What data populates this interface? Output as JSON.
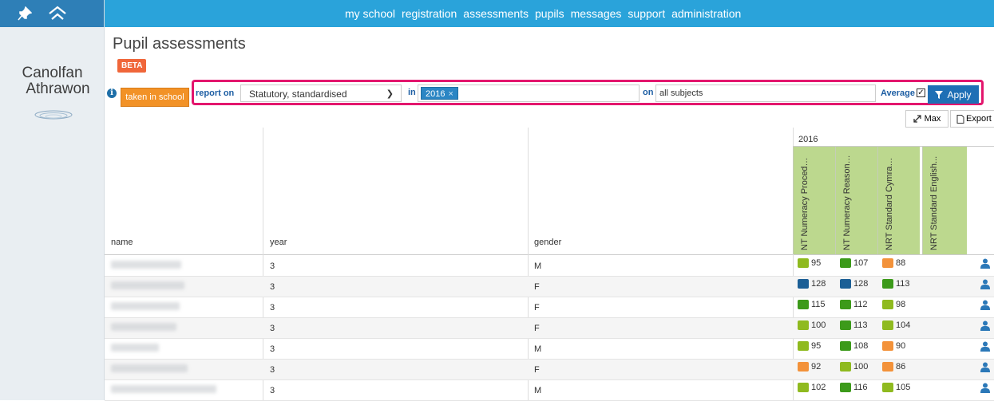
{
  "nav": {
    "items": [
      "my school",
      "registration",
      "assessments",
      "pupils",
      "messages",
      "support",
      "administration"
    ]
  },
  "brand": {
    "line1": "Canolfan",
    "line2": "Athrawon"
  },
  "page": {
    "title": "Pupil assessments",
    "badge": "BETA"
  },
  "filters": {
    "info_icon": "i",
    "taken_label": "taken in school",
    "report_on_label": "report on",
    "report_on_value": "Statutory, standardised",
    "in_label": "in",
    "in_chip": "2016",
    "on_label": "on",
    "on_value": "all subjects",
    "average_label": "Average",
    "average_checked": true,
    "apply_label": "Apply"
  },
  "toolbar": {
    "max_label": "Max",
    "export_label": "Export"
  },
  "table": {
    "headers": {
      "name": "name",
      "year": "year",
      "gender": "gender"
    },
    "year_group": "2016",
    "subjects": [
      "NT Numeracy Procedu...",
      "NT Numeracy Reasoni...",
      "NRT Standard Cymrae...",
      "NRT Standard English..."
    ],
    "rows": [
      {
        "year": "3",
        "gender": "M",
        "scores": [
          [
            "95",
            "lightgreen"
          ],
          [
            "107",
            "green"
          ],
          [
            "88",
            "orange"
          ]
        ]
      },
      {
        "year": "3",
        "gender": "F",
        "scores": [
          [
            "128",
            "blue"
          ],
          [
            "128",
            "blue"
          ],
          [
            "113",
            "green"
          ]
        ]
      },
      {
        "year": "3",
        "gender": "F",
        "scores": [
          [
            "115",
            "green"
          ],
          [
            "112",
            "green"
          ],
          [
            "98",
            "lightgreen"
          ]
        ]
      },
      {
        "year": "3",
        "gender": "F",
        "scores": [
          [
            "100",
            "lightgreen"
          ],
          [
            "113",
            "green"
          ],
          [
            "104",
            "lightgreen"
          ]
        ]
      },
      {
        "year": "3",
        "gender": "M",
        "scores": [
          [
            "95",
            "lightgreen"
          ],
          [
            "108",
            "green"
          ],
          [
            "90",
            "orange"
          ]
        ]
      },
      {
        "year": "3",
        "gender": "F",
        "scores": [
          [
            "92",
            "orange"
          ],
          [
            "100",
            "lightgreen"
          ],
          [
            "86",
            "orange"
          ]
        ]
      },
      {
        "year": "3",
        "gender": "M",
        "scores": [
          [
            "102",
            "lightgreen"
          ],
          [
            "116",
            "green"
          ],
          [
            "105",
            "lightgreen"
          ]
        ]
      }
    ]
  },
  "colors": {
    "lightgreen": "#8fba1f",
    "green": "#3c9a1a",
    "blue": "#1c5f96",
    "orange": "#f3923a",
    "accent": "#2aa3da",
    "highlight": "#e3166d"
  }
}
